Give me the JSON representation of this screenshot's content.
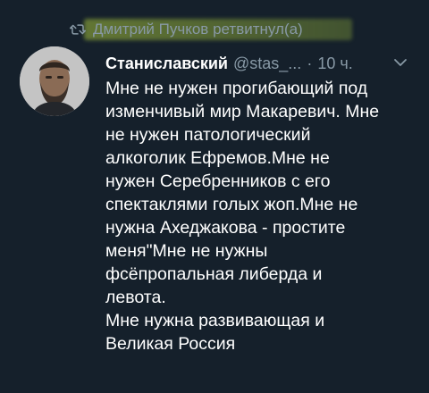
{
  "retweet": {
    "label": "Дмитрий Пучков ретвитнул(а)",
    "icon": "retweet-icon",
    "highlight_color": "#a3be3c"
  },
  "author": {
    "display_name": "Станиславский",
    "handle": "@stas_...",
    "separator": "·",
    "time": "10 ч.",
    "avatar": "avatar-photo"
  },
  "tweet": {
    "lines": [
      "Мне не нужен прогибающий под",
      "изменчивый мир Макаревич. Мне",
      "не нужен патологический",
      "алкоголик Ефремов.Мне не",
      "нужен Серебренников с его",
      "спектаклями голых жоп.Мне не",
      "нужна Ахеджакова - простите",
      "меня\"Мне не нужны",
      "фсёпропальная либерда и",
      "левота.",
      "Мне нужна развивающая и",
      "Великая Россия"
    ]
  },
  "colors": {
    "background": "#15202b",
    "text": "#ffffff",
    "muted": "#8899a6"
  }
}
